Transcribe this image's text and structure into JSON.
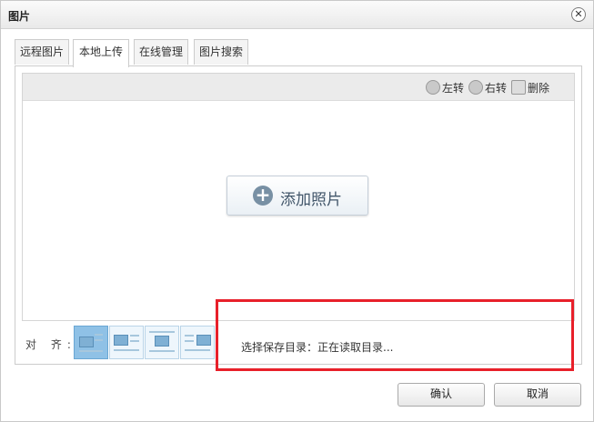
{
  "dialog": {
    "title": "图片",
    "close_glyph": "✕"
  },
  "tabs": [
    {
      "label": "远程图片",
      "active": false
    },
    {
      "label": "本地上传",
      "active": true
    },
    {
      "label": "在线管理",
      "active": false
    },
    {
      "label": "图片搜索",
      "active": false
    }
  ],
  "toolbar": {
    "rotate_left": "左转",
    "rotate_right": "右转",
    "delete": "删除"
  },
  "upload": {
    "add_photo_label": "添加照片"
  },
  "alignment": {
    "label": "对 齐:",
    "options": [
      "none",
      "left",
      "center",
      "right"
    ],
    "selected": "none"
  },
  "save_dir": {
    "text": "选择保存目录：正在读取目录..."
  },
  "footer": {
    "confirm_label": "确认",
    "cancel_label": "取消"
  },
  "colors": {
    "highlight": "#e8202a",
    "accent": "#42566a"
  }
}
